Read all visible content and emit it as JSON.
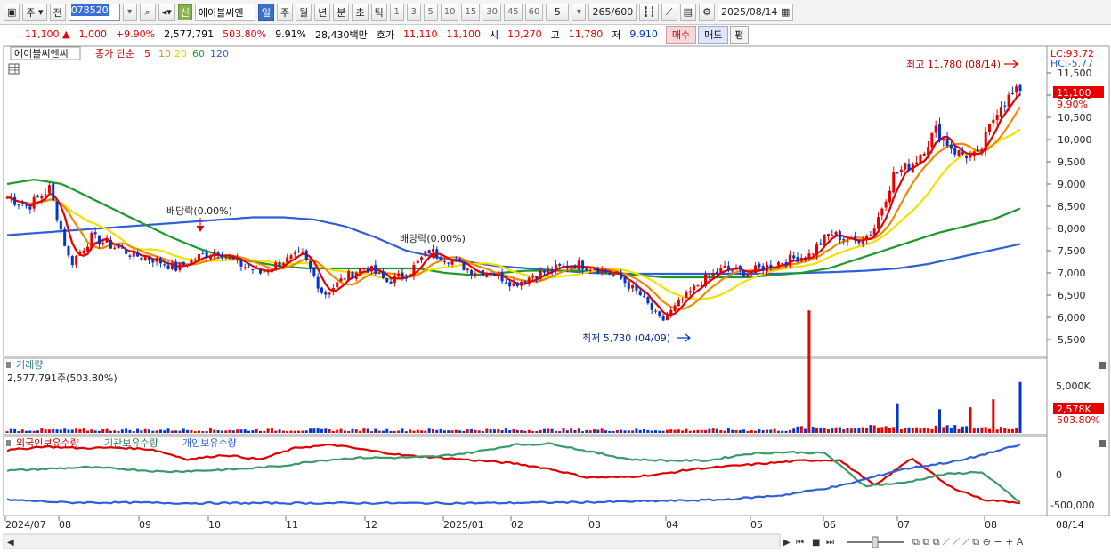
{
  "toolbar": {
    "market": "주",
    "prev_label": "전",
    "code": "078520",
    "new_badge": "신",
    "stock_name": "에이블씨엔",
    "periods": [
      "일",
      "주",
      "월",
      "년",
      "분",
      "초",
      "틱"
    ],
    "selected_period": "일",
    "minute_steps": [
      "1",
      "3",
      "5",
      "10",
      "15",
      "30",
      "45",
      "60"
    ],
    "step_value": "5",
    "count": "265",
    "count_max": "/600",
    "date": "2025/08/14"
  },
  "quote": {
    "price": "11,100",
    "arrow": "▲",
    "change": "1,000",
    "change_pct": "+9.90%",
    "volume": "2,577,791",
    "volume_ratio": "503.80%",
    "turnover": "9.91%",
    "amount": "28,430백만",
    "ask_label": "호가",
    "ask1": "11,110",
    "ask2": "11,100",
    "open_label": "시",
    "open": "10,270",
    "high_label": "고",
    "high": "11,780",
    "low_label": "저",
    "low": "9,910",
    "buy_label": "매수",
    "sell_label": "매도",
    "p_label": "평"
  },
  "legend": {
    "name": "에이블씨엔씨",
    "ma_type": "종가 단순",
    "ma_periods": [
      "5",
      "10",
      "20",
      "60",
      "120"
    ],
    "lc": "LC:93.72",
    "hc": "HC:-5.77"
  },
  "annotations": {
    "high": "최고 11,780 (08/14)",
    "low": "최저 5,730 (04/09)",
    "dividend1": "배당락(0.00%)",
    "dividend2": "배당락(0.00%)"
  },
  "volume_panel": {
    "title": "거래량",
    "value": "2,577,791주(503.80%)",
    "axis_label": "5,000K",
    "last_tag": "2,578K",
    "last_pct": "503.80%"
  },
  "holdings_panel": {
    "series": [
      "외국인보유수량",
      "기관보유수량",
      "개인보유수량"
    ],
    "axis_labels": [
      "0",
      "-500,000"
    ]
  },
  "colors": {
    "up": "#e60000",
    "down": "#0035d0",
    "ma5": "#e60000",
    "ma10": "#f08a00",
    "ma20": "#f2e000",
    "ma60": "#1a9a2a",
    "ma120": "#2f5fd8",
    "foreign": "#e00000",
    "institution": "#3a9a6a",
    "individual": "#2f5fd8"
  },
  "x_ticks": [
    "2024/07",
    "08",
    "09",
    "10",
    "11",
    "12",
    "2025/01",
    "02",
    "03",
    "04",
    "05",
    "06",
    "07",
    "08"
  ],
  "x_right_label": "08/14",
  "chart_data": [
    {
      "type": "line",
      "title": "에이블씨엔씨",
      "ylim": [
        5300,
        11900
      ],
      "y_ticks": [
        5500,
        6000,
        6500,
        7000,
        7500,
        8000,
        8500,
        9000,
        9500,
        10000,
        10500,
        11000,
        11500
      ],
      "x_ticks": [
        "2024/07",
        "08",
        "09",
        "10",
        "11",
        "12",
        "2025/01",
        "02",
        "03",
        "04",
        "05",
        "06",
        "07",
        "08"
      ],
      "last_price": 11100,
      "last_pct": "9.90%",
      "high": {
        "value": 11780,
        "date": "08/14"
      },
      "low": {
        "value": 5730,
        "date": "04/09"
      },
      "close_approx": [
        8700,
        8500,
        8900,
        7200,
        7800,
        7600,
        7400,
        7300,
        7100,
        7350,
        7500,
        7200,
        7000,
        7250,
        7400,
        6500,
        6900,
        7150,
        6800,
        7000,
        7500,
        7300,
        7050,
        7000,
        6750,
        6950,
        7100,
        7200,
        7100,
        6900,
        6500,
        5900,
        6400,
        6850,
        7100,
        7000,
        7150,
        7300,
        7400,
        7900,
        7700,
        7900,
        9200,
        9500,
        10200,
        9700,
        9600,
        10800,
        11100
      ],
      "ma60_approx": [
        9000,
        9100,
        9000,
        8700,
        8400,
        8100,
        7800,
        7550,
        7350,
        7250,
        7150,
        7100,
        7100,
        7100,
        7100,
        7100,
        7000,
        6950,
        7000,
        7050,
        7050,
        7050,
        7000,
        6950,
        6900,
        6900,
        6900,
        6900,
        6950,
        7000,
        7100,
        7300,
        7500,
        7700,
        7900,
        8050,
        8200,
        8450
      ],
      "ma120_approx": [
        7850,
        7900,
        7950,
        8000,
        8050,
        8100,
        8150,
        8200,
        8250,
        8250,
        8200,
        8050,
        7800,
        7500,
        7350,
        7250,
        7150,
        7100,
        7050,
        7000,
        6980,
        6980,
        6980,
        6980,
        6980,
        6980,
        7000,
        7020,
        7050,
        7100,
        7200,
        7350,
        7500,
        7650
      ]
    },
    {
      "type": "bar",
      "title": "거래량",
      "last_value": 2577791,
      "ylim": [
        0,
        6400000
      ],
      "y_ticks": [
        5000000
      ],
      "spikes": [
        {
          "pos": 0.79,
          "value": 6200000
        },
        {
          "pos": 0.877,
          "value": 1500000
        },
        {
          "pos": 0.92,
          "value": 1200000
        },
        {
          "pos": 0.952,
          "value": 1300000
        },
        {
          "pos": 0.9725,
          "value": 1700000
        },
        {
          "pos": 1.0,
          "value": 2577791
        }
      ]
    },
    {
      "type": "line",
      "title": "보유수량",
      "ylim": [
        -850000,
        450000
      ],
      "y_ticks": [
        0,
        -500000
      ],
      "series": [
        {
          "name": "외국인보유수량",
          "values": [
            280000,
            350000,
            320000,
            330000,
            300000,
            120000,
            200000,
            120000,
            330000,
            380000,
            280000,
            190000,
            150000,
            100000,
            50000,
            -50000,
            -200000,
            -200000,
            -150000,
            -50000,
            0,
            50000,
            100000,
            110000,
            -350000,
            150000,
            -350000,
            -600000,
            -650000
          ]
        },
        {
          "name": "기관보유수량",
          "values": [
            -80000,
            -50000,
            -20000,
            -50000,
            -100000,
            -80000,
            -50000,
            0,
            100000,
            150000,
            150000,
            170000,
            250000,
            380000,
            400000,
            250000,
            120000,
            100000,
            100000,
            220000,
            250000,
            230000,
            -350000,
            -300000,
            -150000,
            -100000,
            -650000
          ]
        },
        {
          "name": "개인보유수량",
          "values": [
            -600000,
            -650000,
            -650000,
            -660000,
            -660000,
            -660000,
            -660000,
            -660000,
            -660000,
            -650000,
            -640000,
            -620000,
            -600000,
            -520000,
            -350000,
            -60000,
            100000,
            380000
          ]
        }
      ]
    }
  ]
}
